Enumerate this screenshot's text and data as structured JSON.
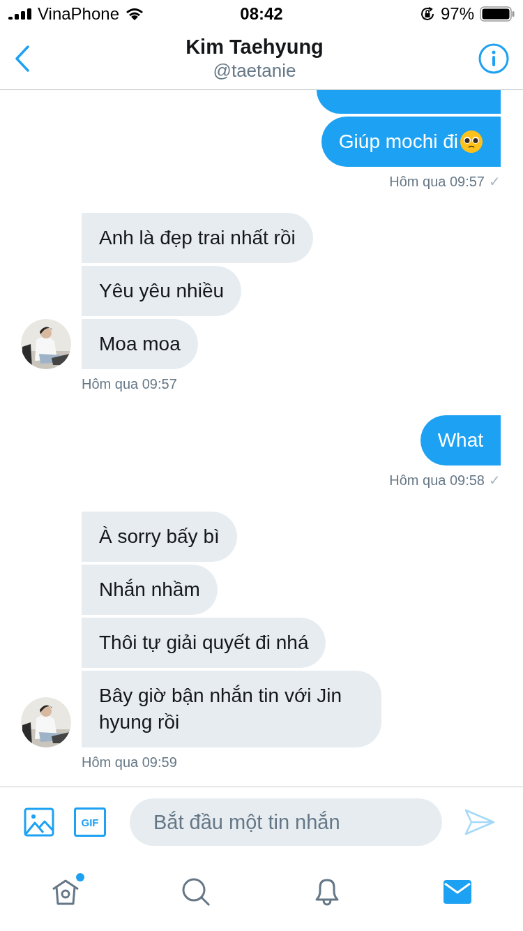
{
  "status_bar": {
    "carrier": "VinaPhone",
    "time": "08:42",
    "battery": "97%"
  },
  "header": {
    "name": "Kim Taehyung",
    "handle": "@taetanie"
  },
  "groups": [
    {
      "kind": "sent",
      "cut_above": true,
      "bubbles": [
        {
          "text": "Giúp mochi đi",
          "pleading_emoji": true
        }
      ],
      "time": "Hôm qua 09:57",
      "receipt": "✓"
    },
    {
      "kind": "received",
      "bubbles": [
        {
          "text": "Anh là đẹp trai nhất rồi"
        },
        {
          "text": "Yêu yêu nhiều"
        },
        {
          "text": "Moa moa"
        }
      ],
      "time": "Hôm qua 09:57"
    },
    {
      "kind": "sent",
      "bubbles": [
        {
          "text": "What"
        }
      ],
      "time": "Hôm qua 09:58",
      "receipt": "✓"
    },
    {
      "kind": "received",
      "bubbles": [
        {
          "text": "À sorry bấy bì"
        },
        {
          "text": "Nhắn nhầm"
        },
        {
          "text": "Thôi tự giải quyết đi nhá"
        },
        {
          "text": "Bây giờ bận nhắn tin với Jin hyung rồi"
        }
      ],
      "time": "Hôm qua 09:59"
    }
  ],
  "composer": {
    "gif_label": "GIF",
    "placeholder": "Bắt đầu một tin nhắn"
  },
  "tabs": [
    {
      "kind": "home",
      "selected": false,
      "dot": true
    },
    {
      "kind": "search",
      "selected": false,
      "dot": false
    },
    {
      "kind": "notifications",
      "selected": false,
      "dot": false
    },
    {
      "kind": "messages",
      "selected": true,
      "dot": false
    }
  ]
}
